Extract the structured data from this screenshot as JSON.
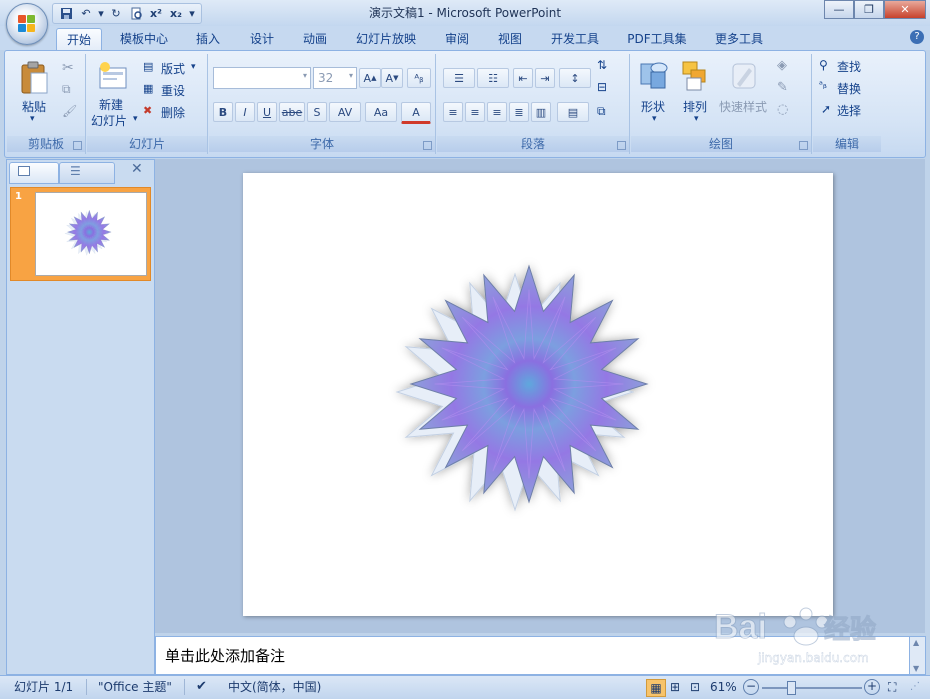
{
  "window": {
    "title": "演示文稿1 - Microsoft PowerPoint"
  },
  "tabs": [
    "开始",
    "模板中心",
    "插入",
    "设计",
    "动画",
    "幻灯片放映",
    "审阅",
    "视图",
    "开发工具",
    "PDF工具集",
    "更多工具"
  ],
  "ribbon": {
    "clipboard": {
      "group": "剪贴板",
      "paste": "粘贴"
    },
    "slides": {
      "group": "幻灯片",
      "new_slide_line1": "新建",
      "new_slide_line2": "幻灯片",
      "layout": "版式",
      "reset": "重设",
      "delete": "删除"
    },
    "font": {
      "group": "字体",
      "size_value": "32",
      "bold": "B",
      "italic": "I",
      "underline": "U",
      "strike": "abe",
      "shadow": "S",
      "spacing": "AV",
      "case": "Aa",
      "color_a": "A"
    },
    "paragraph": {
      "group": "段落"
    },
    "drawing": {
      "group": "绘图",
      "shape": "形状",
      "arrange": "排列",
      "quick_styles": "快速样式"
    },
    "editing": {
      "group": "编辑",
      "find": "查找",
      "replace": "替换",
      "select": "选择"
    }
  },
  "left_panel": {
    "slide_number": "1"
  },
  "notes": {
    "placeholder": "单击此处添加备注"
  },
  "status": {
    "slide": "幻灯片 1/1",
    "theme": "\"Office 主题\"",
    "language": "中文(简体，中国)",
    "zoom": "61%"
  },
  "watermark": {
    "brand": "Baidu经验",
    "url": "jingyan.baidu.com"
  },
  "colors": {
    "accent": "#15428b",
    "star_outer": "#7f9fd6",
    "star_mid": "#9b6fe0",
    "thumb_selected": "#f8a343"
  }
}
